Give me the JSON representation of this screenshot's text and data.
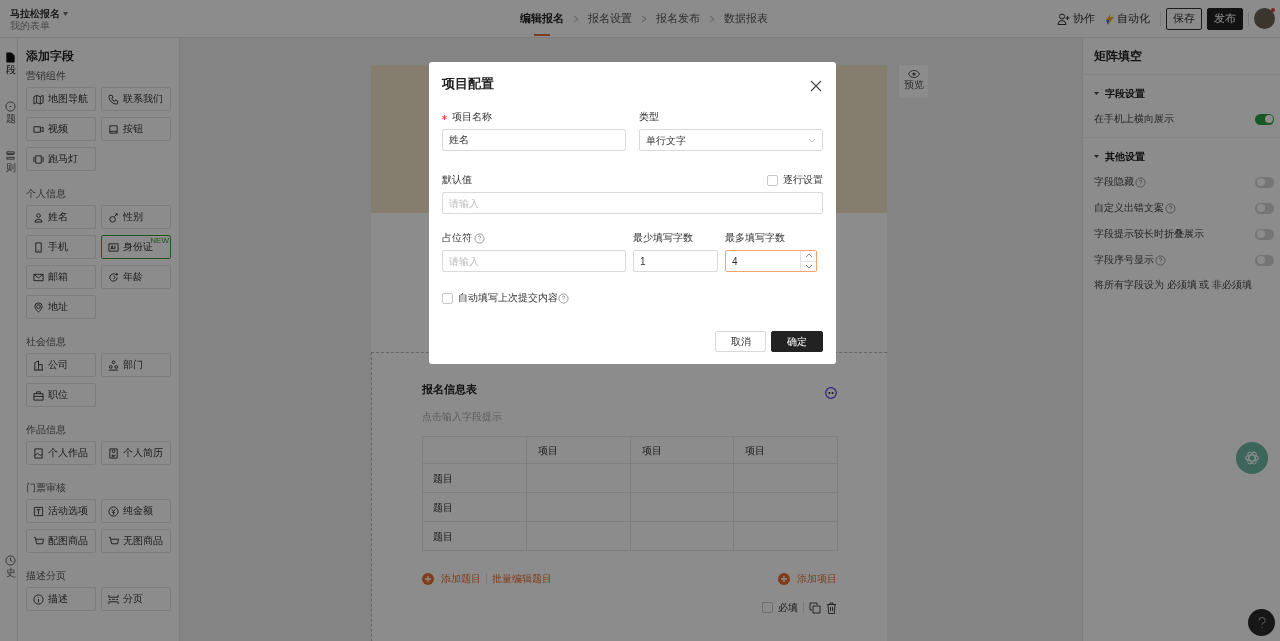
{
  "header": {
    "title": "马拉松报名",
    "subtitle": "我的表单",
    "steps": [
      {
        "label": "编辑报名",
        "selected": true
      },
      {
        "label": "报名设置",
        "selected": false
      },
      {
        "label": "报名发布",
        "selected": false
      },
      {
        "label": "数据报表",
        "selected": false
      }
    ],
    "actions": [
      {
        "label": "协作",
        "kind": "collab"
      },
      {
        "label": "自动化",
        "kind": "automation"
      }
    ],
    "buttons": [
      {
        "label": "保存",
        "kind": "outline"
      },
      {
        "label": "发布",
        "kind": "dark"
      }
    ],
    "avatar": {
      "notification": true
    }
  },
  "rail": [
    {
      "label": "段",
      "kind": "doc",
      "selected": true
    },
    {
      "label": "题",
      "kind": "circle",
      "selected": false
    },
    {
      "label": "则",
      "kind": "list",
      "selected": false
    },
    {
      "label": "史",
      "kind": "clock",
      "selected": false
    }
  ],
  "field_panel": {
    "title": "添加字段",
    "groups": [
      {
        "title": "营销组件",
        "items": [
          {
            "label": "地图导航",
            "kind": "map"
          },
          {
            "label": "联系我们",
            "kind": "phone"
          },
          {
            "label": "视频",
            "kind": "video"
          },
          {
            "label": "按钮",
            "kind": "square"
          },
          {
            "label": "跑马灯",
            "kind": "marquee"
          }
        ]
      },
      {
        "title": "个人信息",
        "items": [
          {
            "label": "姓名",
            "kind": "user"
          },
          {
            "label": "性别",
            "kind": "gender"
          },
          {
            "label": "手机",
            "kind": "mobile"
          },
          {
            "label": "身份证",
            "kind": "idcard",
            "badge": "NEW"
          },
          {
            "label": "邮箱",
            "kind": "mail"
          },
          {
            "label": "年龄",
            "kind": "age"
          },
          {
            "label": "地址",
            "kind": "pin"
          }
        ]
      },
      {
        "title": "社会信息",
        "items": [
          {
            "label": "公司",
            "kind": "building"
          },
          {
            "label": "部门",
            "kind": "org"
          },
          {
            "label": "职位",
            "kind": "briefcase"
          }
        ]
      },
      {
        "title": "作品信息",
        "items": [
          {
            "label": "个人作品",
            "kind": "image"
          },
          {
            "label": "个人简历",
            "kind": "resume"
          }
        ]
      },
      {
        "title": "门票审核",
        "items": [
          {
            "label": "活动选项",
            "kind": "text"
          },
          {
            "label": "纯金额",
            "kind": "yen"
          },
          {
            "label": "配图商品",
            "kind": "cart"
          },
          {
            "label": "无图商品",
            "kind": "cart"
          }
        ]
      },
      {
        "title": "描述分页",
        "items": [
          {
            "label": "描述",
            "kind": "info"
          },
          {
            "label": "分页",
            "kind": "page"
          }
        ]
      }
    ]
  },
  "canvas": {
    "preview": {
      "label": "预览"
    },
    "matrix": {
      "title": "报名信息表",
      "hint": "点击输入字段提示",
      "columns": [
        "项目",
        "项目",
        "项目"
      ],
      "rows": [
        "题目",
        "题目",
        "题目"
      ],
      "add_row": "添加题目",
      "batch_edit": "批量编辑题目",
      "add_column": "添加项目",
      "required": {
        "label": "必填",
        "checked": false
      }
    }
  },
  "settings_panel": {
    "title": "矩阵填空",
    "sections": [
      {
        "title": "字段设置",
        "expanded": true,
        "settings": [
          {
            "label": "在手机上横向展示",
            "help": false,
            "on": true
          }
        ]
      },
      {
        "title": "其他设置",
        "expanded": true,
        "settings": [
          {
            "label": "字段隐藏",
            "help": true,
            "on": false
          },
          {
            "label": "自定义出错文案",
            "help": true,
            "on": false
          },
          {
            "label": "字段提示较长时折叠展示",
            "help": false,
            "on": false
          },
          {
            "label": "字段序号显示",
            "help": true,
            "on": false
          }
        ]
      }
    ],
    "footer": {
      "prefix": "将所有字段设为",
      "link_required": "必须填",
      "conjunction": "或",
      "link_optional": "非必须填"
    }
  },
  "dialog": {
    "title": "项目配置",
    "name": {
      "label": "项目名称",
      "required": true,
      "value": "姓名"
    },
    "type": {
      "label": "类型",
      "value": "单行文字"
    },
    "default": {
      "label": "默认值",
      "placeholder": "请输入",
      "per_row": {
        "label": "逐行设置",
        "checked": false
      }
    },
    "placeholder_field": {
      "label": "占位符",
      "help": true,
      "placeholder": "请输入"
    },
    "min_chars": {
      "label": "最少填写字数",
      "value": "1",
      "focused": false
    },
    "max_chars": {
      "label": "最多填写字数",
      "value": "4",
      "focused": true
    },
    "autofill": {
      "label": "自动填写上次提交内容",
      "help": true,
      "checked": false
    },
    "buttons": [
      {
        "label": "取消",
        "kind": "secondary"
      },
      {
        "label": "确定",
        "kind": "primary"
      }
    ]
  }
}
